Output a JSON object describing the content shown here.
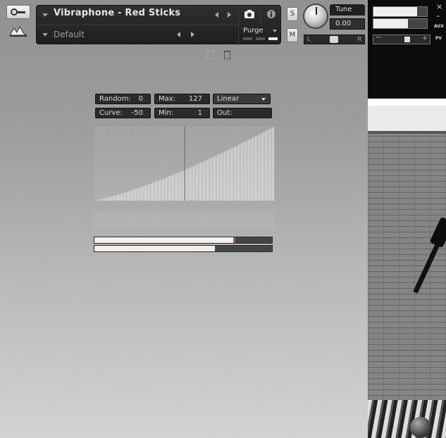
{
  "header": {
    "instrument_name": "Vibraphone - Red Sticks",
    "preset_name": "Default",
    "purge_label": "Purge",
    "solo_label": "S",
    "mute_label": "M",
    "tune_label": "Tune",
    "tune_value": "0.00",
    "pan_left": "L",
    "pan_right": "R",
    "icons": {
      "wrench": "wrench-icon",
      "camera": "camera-icon",
      "info": "info-icon",
      "save": "save-icon",
      "trash": "trash-icon"
    }
  },
  "output": {
    "close": "×",
    "minimize": "–",
    "aux_label": "AUX",
    "pv_label": "PV",
    "vol_minus": "−",
    "vol_plus": "+",
    "meter_top_level": 0.82,
    "meter_bottom_level": 0.64
  },
  "velocity": {
    "random_label": "Random:",
    "random_value": "0",
    "max_label": "Max:",
    "max_value": "127",
    "curve_label": "Curve:",
    "curve_value": "-50",
    "min_label": "Min:",
    "min_value": "1",
    "mode_value": "Linear",
    "out_label": "Out:",
    "out_value": "",
    "bar1_level": 0.78,
    "bar2_level": 0.68
  },
  "colors": {
    "panel_dark": "#2b2b2b",
    "bar_fill": "#f2efec",
    "bar_marker": "#a06060"
  }
}
